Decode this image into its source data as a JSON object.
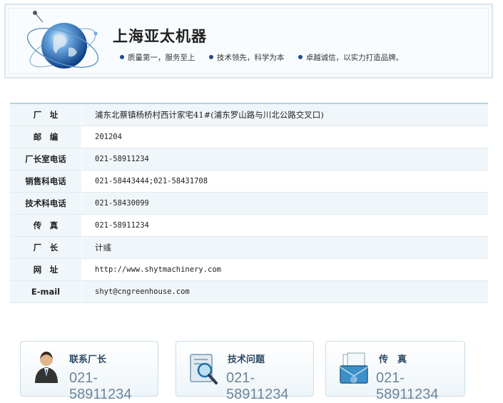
{
  "header": {
    "company_name": "上海亚太机器",
    "slogans": [
      "质量第一，服务至上",
      "技术领先，科学为本",
      "卓越诚信，以实力打造品牌。"
    ]
  },
  "info_table": [
    {
      "label": "厂　址",
      "value": "浦东北蔡镇杨桥村西计家宅41#(浦东罗山路与川北公路交叉口)"
    },
    {
      "label": "邮　编",
      "value": "201204"
    },
    {
      "label": "厂长室电话",
      "value": "021-58911234"
    },
    {
      "label": "销售科电话",
      "value": "021-58443444;021-58431708"
    },
    {
      "label": "技术科电话",
      "value": "021-58430099"
    },
    {
      "label": "传　真",
      "value": "021-58911234"
    },
    {
      "label": "厂　长",
      "value": "计彧"
    },
    {
      "label": "网　址",
      "value": "http://www.shytmachinery.com"
    },
    {
      "label": "E-mail",
      "value": "shyt@cngreenhouse.com"
    }
  ],
  "cards": [
    {
      "title": "联系厂长",
      "phone": "021-58911234",
      "icon": "person-icon"
    },
    {
      "title": "技术问题",
      "phone": "021-58911234",
      "icon": "magnifier-document-icon"
    },
    {
      "title": "传　真",
      "phone": "021-58911234",
      "icon": "fax-mail-icon"
    }
  ],
  "colors": {
    "accent": "#1c4f8a",
    "table_stripe": "#f0f6f9",
    "border": "#c9dde8",
    "phone_text": "#6f8596"
  }
}
